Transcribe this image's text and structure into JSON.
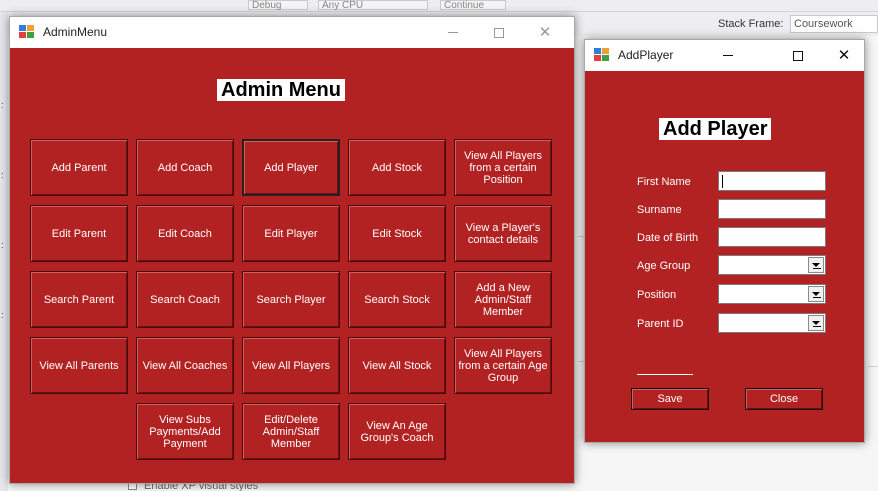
{
  "ide": {
    "combo_debug": "Debug",
    "combo_cpu": "Any CPU",
    "continue_label": "Continue",
    "stack_frame_label": "Stack Frame:",
    "stack_frame_value": "Coursework",
    "bottom_option": "Enable XP visual styles"
  },
  "admin_menu": {
    "window_title": "AdminMenu",
    "heading": "Admin Menu",
    "buttons": [
      "Add Parent",
      "Add Coach",
      "Add Player",
      "Add Stock",
      "View All Players from a certain Position",
      "Edit Parent",
      "Edit Coach",
      "Edit Player",
      "Edit Stock",
      "View a Player's contact details",
      "Search Parent",
      "Search Coach",
      "Search Player",
      "Search Stock",
      "Add a New Admin/Staff Member",
      "View All Parents",
      "View All Coaches",
      "View All Players",
      "View All Stock",
      "View All Players from a certain Age Group",
      "View Subs Payments/Add Payment",
      "Edit/Delete Admin/Staff Member",
      "View An Age Group's Coach"
    ]
  },
  "add_player": {
    "window_title": "AddPlayer",
    "heading": "Add Player",
    "labels": {
      "first_name": "First Name",
      "surname": "Surname",
      "dob": "Date of Birth",
      "age_group": "Age Group",
      "position": "Position",
      "parent_id": "Parent ID"
    },
    "values": {
      "first_name": "",
      "surname": "",
      "dob": "",
      "age_group": "",
      "position": "",
      "parent_id": ""
    },
    "save_label": "Save",
    "close_label": "Close"
  },
  "colors": {
    "form_background": "#b22222",
    "button_text": "#ffffff"
  }
}
